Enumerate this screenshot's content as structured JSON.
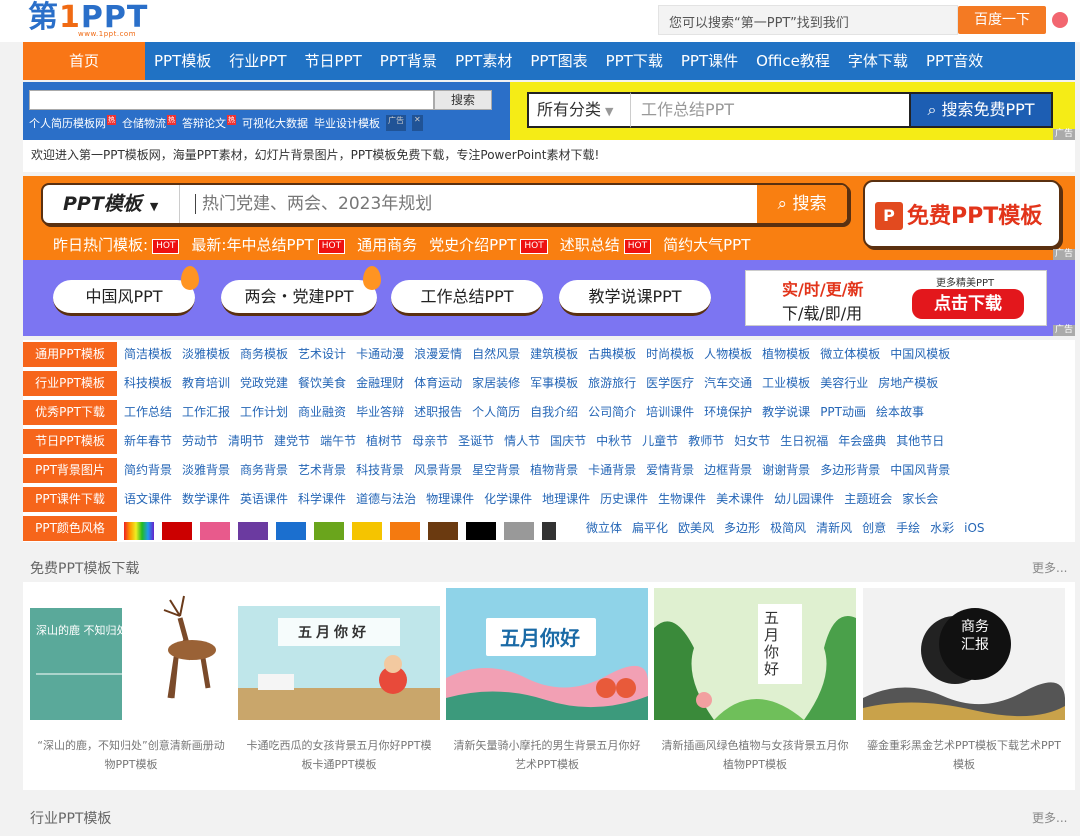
{
  "logo": {
    "main_a": "第",
    "main_b": "1",
    "main_c": "PPT",
    "sub": "www.1ppt.com"
  },
  "baidu": {
    "placeholder": "您可以搜索“第一PPT”找到我们",
    "button": "百度一下"
  },
  "nav": {
    "home": "首页",
    "items": [
      "PPT模板",
      "行业PPT",
      "节日PPT",
      "PPT背景",
      "PPT素材",
      "PPT图表",
      "PPT下载",
      "PPT课件",
      "Office教程",
      "字体下载",
      "PPT音效"
    ]
  },
  "search_left": {
    "button": "搜索",
    "links": [
      "个人简历模板网",
      "仓储物流",
      "答辩论文",
      "可视化大数据",
      "毕业设计模板"
    ],
    "ad": "广告"
  },
  "search_right": {
    "category": "所有分类",
    "placeholder": "工作总结PPT",
    "button": "搜索免费PPT",
    "ad": "广告"
  },
  "welcome": "欢迎进入第一PPT模板网，海量PPT素材，幻灯片背景图片，PPT模板免费下载，专注PowerPoint素材下载!",
  "promo": {
    "select": "PPT模板",
    "placeholder": "热门党建、两会、2023年规划",
    "button": "搜索",
    "free_button": "免费PPT模板",
    "links": [
      {
        "text": "昨日热门模板:",
        "hot": "HOT"
      },
      {
        "text": "最新:年中总结PPT",
        "hot": "HOT"
      },
      {
        "text": "通用商务",
        "hot": ""
      },
      {
        "text": "党史介绍PPT",
        "hot": "HOT"
      },
      {
        "text": "述职总结",
        "hot": "HOT"
      },
      {
        "text": "简约大气PPT",
        "hot": ""
      }
    ],
    "ad": "广告"
  },
  "pills": {
    "items": [
      "中国风PPT",
      "两会・党建PPT",
      "工作总结PPT",
      "教学说课PPT"
    ],
    "dl_t1": "实/时/更/新",
    "dl_t2": "下/载/即/用",
    "dl_more": "更多精美PPT",
    "dl_btn": "点击下载",
    "ad": "广告"
  },
  "categories": [
    {
      "tag": "通用PPT模板",
      "links": [
        "简洁模板",
        "淡雅模板",
        "商务模板",
        "艺术设计",
        "卡通动漫",
        "浪漫爱情",
        "自然风景",
        "建筑模板",
        "古典模板",
        "时尚模板",
        "人物模板",
        "植物模板",
        "微立体模板",
        "中国风模板"
      ]
    },
    {
      "tag": "行业PPT模板",
      "links": [
        "科技模板",
        "教育培训",
        "党政党建",
        "餐饮美食",
        "金融理财",
        "体育运动",
        "家居装修",
        "军事模板",
        "旅游旅行",
        "医学医疗",
        "汽车交通",
        "工业模板",
        "美容行业",
        "房地产模板"
      ]
    },
    {
      "tag": "优秀PPT下载",
      "links": [
        "工作总结",
        "工作汇报",
        "工作计划",
        "商业融资",
        "毕业答辩",
        "述职报告",
        "个人简历",
        "自我介绍",
        "公司简介",
        "培训课件",
        "环境保护",
        "教学说课",
        "PPT动画",
        "绘本故事"
      ]
    },
    {
      "tag": "节日PPT模板",
      "links": [
        "新年春节",
        "劳动节",
        "清明节",
        "建党节",
        "端午节",
        "植树节",
        "母亲节",
        "圣诞节",
        "情人节",
        "国庆节",
        "中秋节",
        "儿童节",
        "教师节",
        "妇女节",
        "生日祝福",
        "年会盛典",
        "其他节日"
      ]
    },
    {
      "tag": "PPT背景图片",
      "links": [
        "简约背景",
        "淡雅背景",
        "商务背景",
        "艺术背景",
        "科技背景",
        "风景背景",
        "星空背景",
        "植物背景",
        "卡通背景",
        "爱情背景",
        "边框背景",
        "谢谢背景",
        "多边形背景",
        "中国风背景"
      ]
    },
    {
      "tag": "PPT课件下载",
      "links": [
        "语文课件",
        "数学课件",
        "英语课件",
        "科学课件",
        "道德与法治",
        "物理课件",
        "化学课件",
        "地理课件",
        "历史课件",
        "生物课件",
        "美术课件",
        "幼儿园课件",
        "主题班会",
        "家长会"
      ]
    }
  ],
  "color_row": {
    "tag": "PPT颜色风格",
    "colors": [
      "#cc0000",
      "#e85a8c",
      "#6b3aa0",
      "#1b6fcf",
      "#6aa51c",
      "#f5c400",
      "#f47a10",
      "#6b3a10",
      "#000000",
      "#999999",
      "#333333"
    ],
    "styles": [
      "微立体",
      "扁平化",
      "欧美风",
      "多边形",
      "极简风",
      "清新风",
      "创意",
      "手绘",
      "水彩",
      "iOS"
    ]
  },
  "free_section": {
    "title": "免费PPT模板下载",
    "more": "更多..."
  },
  "cards": [
    {
      "thumb_text": "深山的鹿 不知归处",
      "caption": "“深山的鹿，不知归处”创意清新画册动物PPT模板"
    },
    {
      "thumb_text": "五月你好",
      "caption": "卡通吃西瓜的女孩背景五月你好PPT模板卡通PPT模板"
    },
    {
      "thumb_text": "五月你好",
      "caption": "清新矢量骑小摩托的男生背景五月你好艺术PPT模板"
    },
    {
      "thumb_text": "五月你好",
      "caption": "清新插画风绿色植物与女孩背景五月你植物PPT模板"
    },
    {
      "thumb_text": "商务汇报",
      "caption": "鎏金重彩黑金艺术PPT模板下载艺术PPT模板"
    }
  ],
  "industry_section": {
    "title": "行业PPT模板",
    "more": "更多..."
  }
}
